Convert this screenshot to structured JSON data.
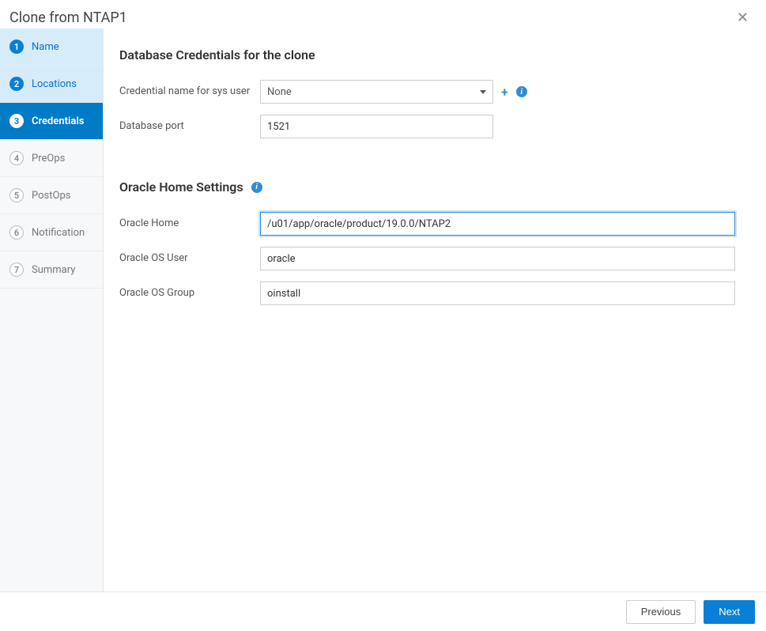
{
  "dialog": {
    "title": "Clone from NTAP1"
  },
  "steps": [
    {
      "num": "1",
      "label": "Name"
    },
    {
      "num": "2",
      "label": "Locations"
    },
    {
      "num": "3",
      "label": "Credentials"
    },
    {
      "num": "4",
      "label": "PreOps"
    },
    {
      "num": "5",
      "label": "PostOps"
    },
    {
      "num": "6",
      "label": "Notification"
    },
    {
      "num": "7",
      "label": "Summary"
    }
  ],
  "credentials": {
    "section_title": "Database Credentials for the clone",
    "cred_name_label": "Credential name for sys user",
    "cred_name_value": "None",
    "db_port_label": "Database port",
    "db_port_value": "1521"
  },
  "oracle": {
    "section_title": "Oracle Home Settings",
    "home_label": "Oracle Home",
    "home_value": "/u01/app/oracle/product/19.0.0/NTAP2",
    "os_user_label": "Oracle OS User",
    "os_user_value": "oracle",
    "os_group_label": "Oracle OS Group",
    "os_group_value": "oinstall"
  },
  "footer": {
    "previous": "Previous",
    "next": "Next"
  }
}
